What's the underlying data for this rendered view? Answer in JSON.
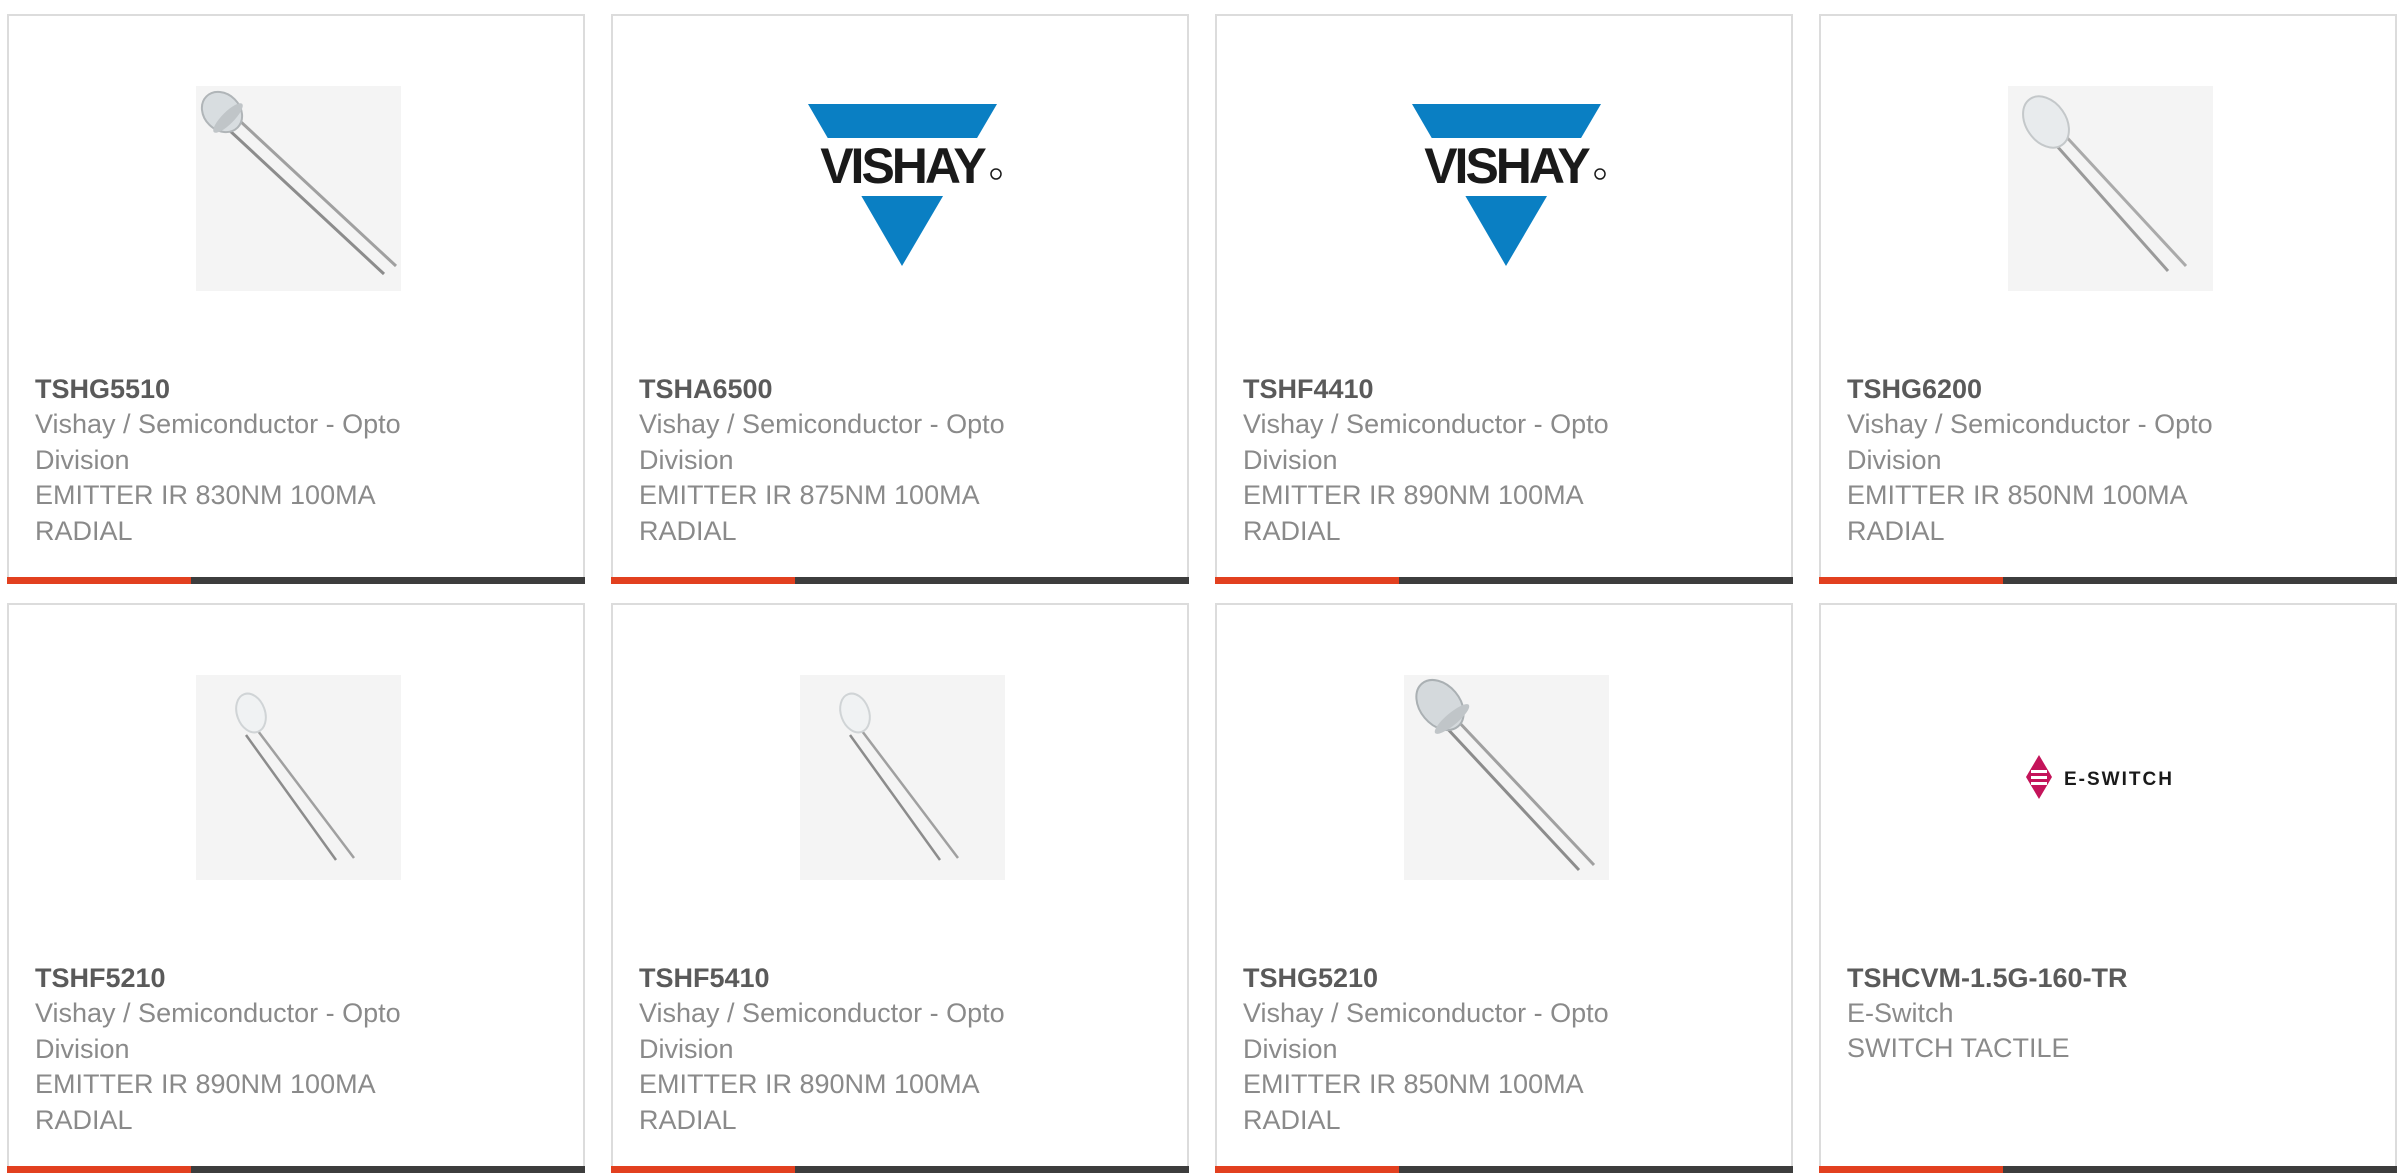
{
  "colors": {
    "accent": "#e2401f",
    "bar": "#3d3d3d",
    "vishay_blue": "#0a7fc3",
    "eswitch_magenta": "#c4145a"
  },
  "products": [
    {
      "part": "TSHG5510",
      "manufacturer": "Vishay / Semiconductor - Opto Division",
      "description": "EMITTER IR 830NM 100MA RADIAL",
      "image": "ir-led-photo"
    },
    {
      "part": "TSHA6500",
      "manufacturer": "Vishay / Semiconductor - Opto Division",
      "description": "EMITTER IR 875NM 100MA RADIAL",
      "image": "vishay-logo"
    },
    {
      "part": "TSHF4410",
      "manufacturer": "Vishay / Semiconductor - Opto Division",
      "description": "EMITTER IR 890NM 100MA RADIAL",
      "image": "vishay-logo"
    },
    {
      "part": "TSHG6200",
      "manufacturer": "Vishay / Semiconductor - Opto Division",
      "description": "EMITTER IR 850NM 100MA RADIAL",
      "image": "ir-led-photo"
    },
    {
      "part": "TSHF5210",
      "manufacturer": "Vishay / Semiconductor - Opto Division",
      "description": "EMITTER IR 890NM 100MA RADIAL",
      "image": "ir-led-photo"
    },
    {
      "part": "TSHF5410",
      "manufacturer": "Vishay / Semiconductor - Opto Division",
      "description": "EMITTER IR 890NM 100MA RADIAL",
      "image": "ir-led-photo"
    },
    {
      "part": "TSHG5210",
      "manufacturer": "Vishay / Semiconductor - Opto Division",
      "description": "EMITTER IR 850NM 100MA RADIAL",
      "image": "ir-led-photo"
    },
    {
      "part": "TSHCVM-1.5G-160-TR",
      "manufacturer": "E-Switch",
      "description": "SWITCH TACTILE",
      "image": "eswitch-logo"
    }
  ],
  "logos": {
    "vishay": "VISHAY",
    "eswitch": "E-SWITCH"
  }
}
